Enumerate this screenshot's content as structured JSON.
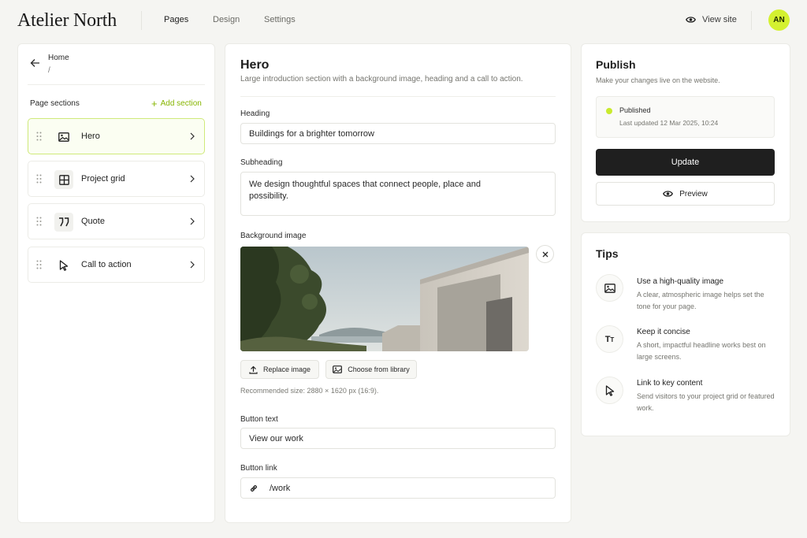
{
  "app": {
    "logo": "Atelier North"
  },
  "nav": {
    "pages": "Pages",
    "design": "Design",
    "settings": "Settings"
  },
  "header": {
    "view_site": "View site",
    "avatar": "AN"
  },
  "left": {
    "breadcrumb_home": "Home",
    "breadcrumb_slash": "/",
    "sections_title": "Page sections",
    "add_section": "Add section",
    "sections": [
      {
        "label": "Hero",
        "icon": "image-icon"
      },
      {
        "label": "Project grid",
        "icon": "grid-icon"
      },
      {
        "label": "Quote",
        "icon": "quote-icon"
      },
      {
        "label": "Call to action",
        "icon": "cursor-icon"
      }
    ]
  },
  "editor": {
    "title": "Hero",
    "subtitle": "Large introduction section with a background image, heading and a call to action.",
    "heading_label": "Heading",
    "heading_value": "Buildings for a brighter tomorrow",
    "subheading_label": "Subheading",
    "subheading_value": "We design thoughtful spaces that connect people, place and possibility.",
    "bg_label": "Background image",
    "replace_image": "Replace image",
    "choose_library": "Choose from library",
    "recommended": "Recommended size: 2880 × 1620 px (16:9).",
    "button_text_label": "Button text",
    "button_text_value": "View our work",
    "button_link_label": "Button link",
    "button_link_value": "/work"
  },
  "publish": {
    "title": "Publish",
    "subtitle": "Make your changes live on the website.",
    "status": "Published",
    "last_updated": "Last updated 12 Mar 2025, 10:24",
    "update": "Update",
    "preview": "Preview"
  },
  "tips": {
    "title": "Tips",
    "items": [
      {
        "title": "Use a high-quality image",
        "desc": "A clear, atmospheric image helps set the tone for your page.",
        "icon": "image-icon"
      },
      {
        "title": "Keep it concise",
        "desc": "A short, impactful headline works best on large screens.",
        "icon": "text-icon"
      },
      {
        "title": "Link to key content",
        "desc": "Send visitors to your project grid or featured work.",
        "icon": "cursor-icon"
      }
    ]
  },
  "colors": {
    "accent": "#c9ea2e",
    "dark": "#1f1f1f"
  }
}
